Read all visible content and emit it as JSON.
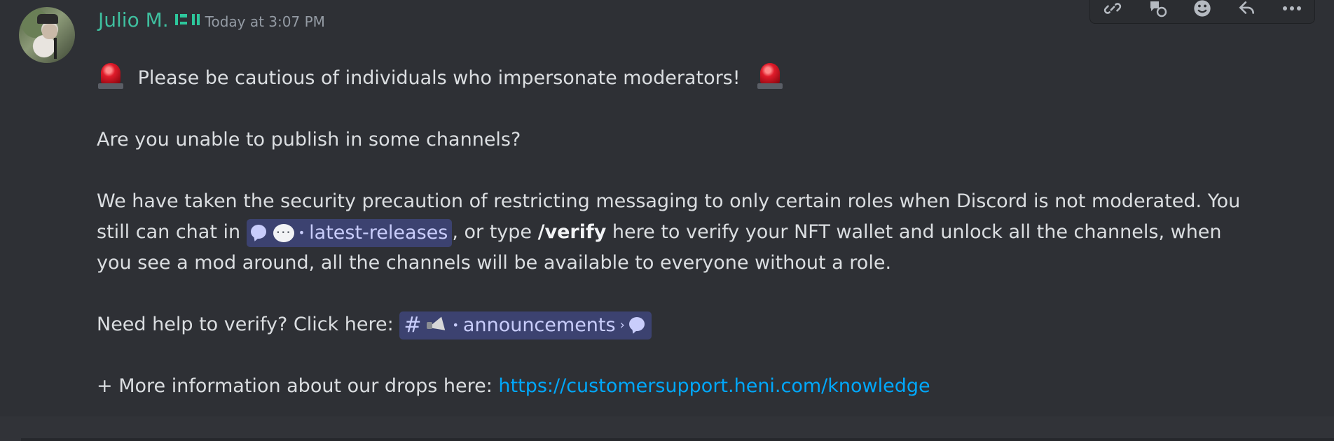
{
  "message": {
    "author": "Julio M.",
    "timestamp": "Today at 3:07 PM",
    "warning": "Please be cautious of individuals who impersonate moderators!",
    "question": "Are you unable to publish in some channels?",
    "para_line1": "We have taken the security precaution of restricting messaging to only certain roles when Discord is not moderated. You",
    "para_line2_a": "still can chat in",
    "channel1": "latest-releases",
    "para_line2_b": ", or type",
    "command": "/verify",
    "para_line2_c": "here to verify your NFT wallet and unlock all the channels, when",
    "para_line3": "you see a mod around, all the channels will be available to everyone without a role.",
    "help_text": "Need help to verify? Click here:",
    "channel2_hash": "#",
    "channel2": "announcements",
    "more_info": "+ More information about our drops here:",
    "link_url": "https://customersupport.heni.com/knowledge"
  },
  "toolbar": {
    "icons": [
      "link-icon",
      "reply-react-icon",
      "emoji-icon",
      "reply-icon",
      "more-icon"
    ]
  },
  "colors": {
    "background": "#2e3035",
    "username": "#3fbf9f",
    "mention_bg": "#3c4270",
    "mention_text": "#c9cdfb",
    "link": "#00a8fc"
  }
}
